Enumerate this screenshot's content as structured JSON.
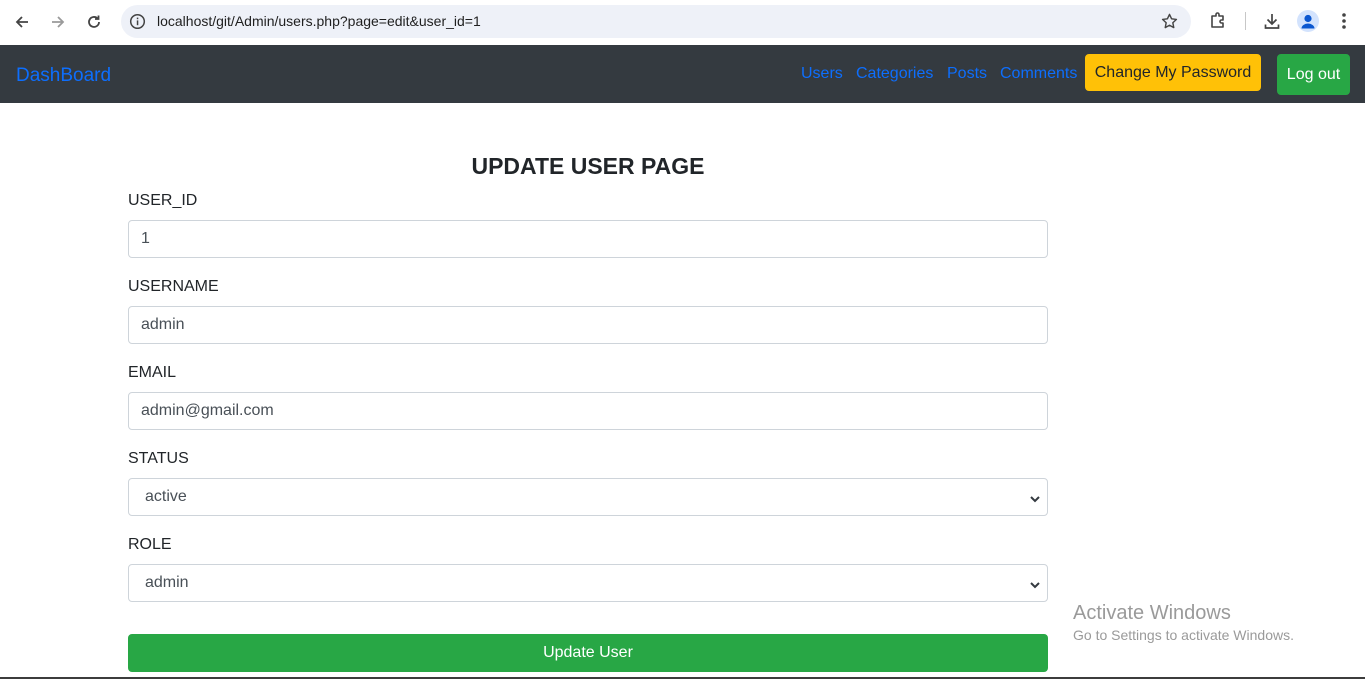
{
  "browser": {
    "url": "localhost/git/Admin/users.php?page=edit&user_id=1",
    "icons": [
      "back-icon",
      "forward-icon",
      "reload-icon",
      "info-icon",
      "star-icon",
      "extensions-icon",
      "download-icon",
      "profile-icon",
      "menu-icon"
    ]
  },
  "navbar": {
    "brand": "DashBoard",
    "links": [
      "Users",
      "Categories",
      "Posts",
      "Comments"
    ],
    "change_password": "Change My Password",
    "logout": "Log out",
    "colors": {
      "background": "#343a40",
      "link": "#0d6efd",
      "warning": "#ffc107",
      "success": "#28a745"
    }
  },
  "form": {
    "title": "UPDATE USER PAGE",
    "user_id_label": "USER_ID",
    "user_id_value": "1",
    "username_label": "USERNAME",
    "username_value": "admin",
    "email_label": "EMAIL",
    "email_value": "admin@gmail.com",
    "status_label": "STATUS",
    "status_value": "active",
    "role_label": "ROLE",
    "role_value": "admin",
    "submit": "Update User"
  },
  "watermark": {
    "title": "Activate Windows",
    "subtitle": "Go to Settings to activate Windows."
  }
}
